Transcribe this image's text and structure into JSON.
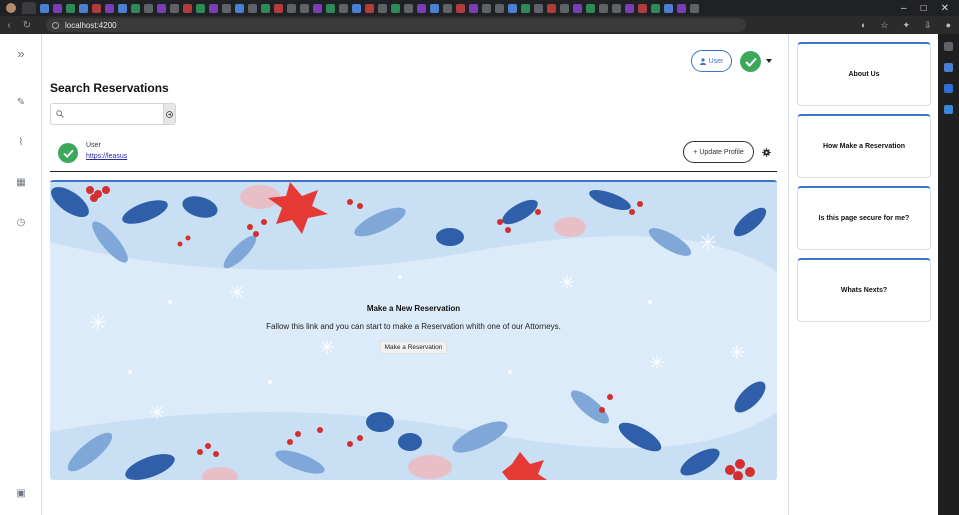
{
  "browser": {
    "url": "localhost:4200",
    "colors": {
      "chrome": "#202124",
      "toolbar": "#2b2b2b"
    }
  },
  "header": {
    "user_button_label": "User",
    "status_icon": "check-circle-icon",
    "menu_icon": "caret-down-icon"
  },
  "main": {
    "title": "Search Reservations",
    "search": {
      "placeholder": "",
      "value": ""
    }
  },
  "profile": {
    "name": "User",
    "link": "https://leasus",
    "update_button_label": "Update Profile",
    "update_button_prefix": "+"
  },
  "banner": {
    "title": "Make a New Reservation",
    "text": "Fallow this link and you can start to make a Reservation whith one of our Attorneys.",
    "button_label": "Make a Reservation"
  },
  "info_cards": [
    {
      "label": "About Us"
    },
    {
      "label": "How Make a Reservation"
    },
    {
      "label": "Is this page secure for me?"
    },
    {
      "label": "Whats Nexts?"
    }
  ],
  "colors": {
    "accent": "#3d74c9",
    "success": "#3ca95a",
    "banner_bg": "#dcebf9"
  }
}
